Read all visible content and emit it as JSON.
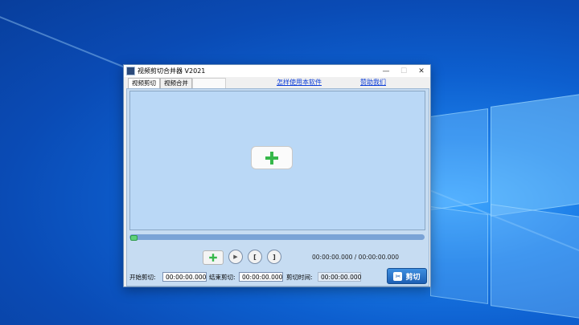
{
  "window": {
    "title": "视频剪切合并器 V2021",
    "min_glyph": "—",
    "max_glyph": "☐",
    "close_glyph": "✕"
  },
  "tabs": [
    {
      "label": "视频剪切",
      "active": true
    },
    {
      "label": "视频合并",
      "active": false
    }
  ],
  "links": {
    "how_to_use": "怎样使用本软件",
    "sponsor": "赞助我们"
  },
  "preview": {
    "add_button_icon": "plus-icon"
  },
  "progress": {
    "value": 0.02
  },
  "controls": {
    "play_glyph": "▶",
    "mark_start_glyph": "[",
    "mark_end_glyph": "]",
    "time_readout": "00:00:00.000 / 00:00:00.000"
  },
  "cut_form": {
    "start_label": "开始剪切:",
    "start_value": "00:00:00.000",
    "end_label": "结束剪切:",
    "end_value": "00:00:00.000",
    "duration_label": "剪切时间:",
    "duration_value": "00:00:00.000",
    "cut_button": "剪切"
  },
  "colors": {
    "accent": "#1d5fb4",
    "preview_bg": "#bad8f6",
    "plus_green": "#36b84a",
    "link": "#0b3dd8"
  }
}
